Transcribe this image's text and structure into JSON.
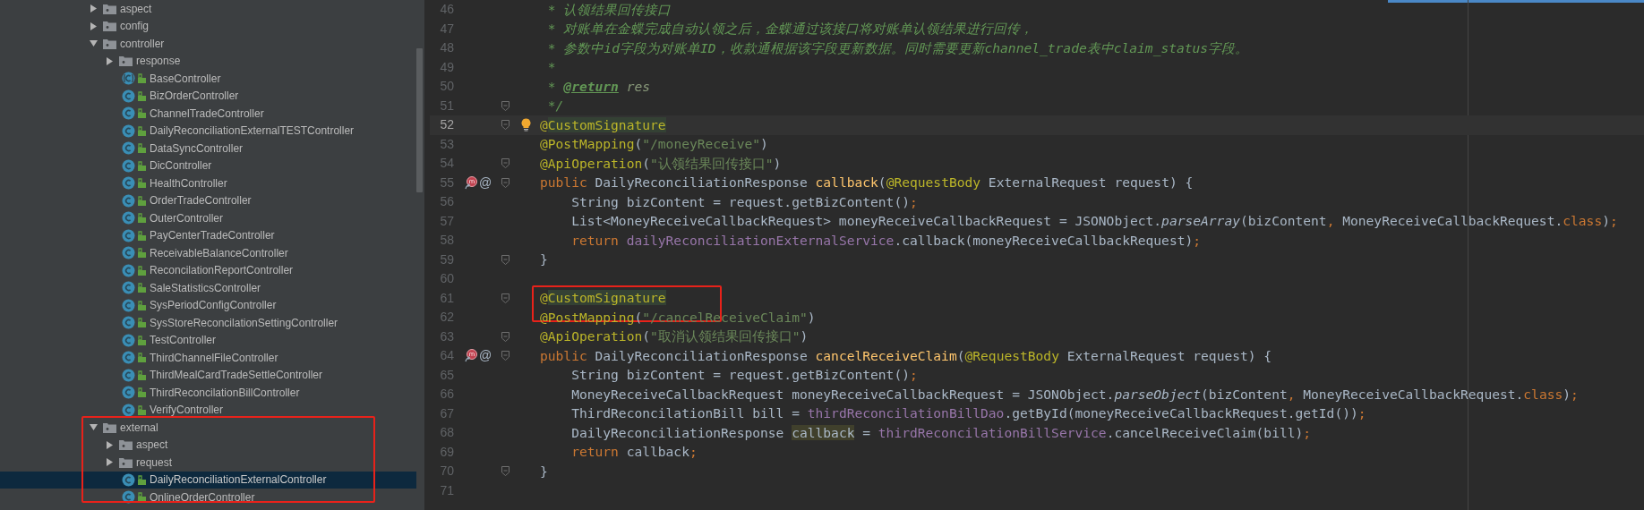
{
  "project_tree": {
    "items": [
      {
        "kind": "package",
        "label": "aspect",
        "expanded": false,
        "selected": false,
        "highlighted": false
      },
      {
        "kind": "package",
        "label": "config",
        "expanded": false,
        "selected": false,
        "highlighted": false
      },
      {
        "kind": "package",
        "label": "controller",
        "expanded": true,
        "selected": false,
        "highlighted": false,
        "children": [
          {
            "kind": "package",
            "label": "response",
            "expanded": false,
            "selected": false
          },
          {
            "kind": "abstract_class",
            "label": "BaseController",
            "selected": false
          },
          {
            "kind": "class",
            "label": "BizOrderController",
            "selected": false
          },
          {
            "kind": "class",
            "label": "ChannelTradeController",
            "selected": false
          },
          {
            "kind": "class",
            "label": "DailyReconciliationExternalTESTController",
            "selected": false
          },
          {
            "kind": "class",
            "label": "DataSyncController",
            "selected": false
          },
          {
            "kind": "class",
            "label": "DicController",
            "selected": false
          },
          {
            "kind": "class",
            "label": "HealthController",
            "selected": false
          },
          {
            "kind": "class",
            "label": "OrderTradeController",
            "selected": false
          },
          {
            "kind": "class",
            "label": "OuterController",
            "selected": false
          },
          {
            "kind": "class",
            "label": "PayCenterTradeController",
            "selected": false
          },
          {
            "kind": "class",
            "label": "ReceivableBalanceController",
            "selected": false
          },
          {
            "kind": "class",
            "label": "ReconcilationReportController",
            "selected": false
          },
          {
            "kind": "class",
            "label": "SaleStatisticsController",
            "selected": false
          },
          {
            "kind": "class",
            "label": "SysPeriodConfigController",
            "selected": false
          },
          {
            "kind": "class",
            "label": "SysStoreReconcilationSettingController",
            "selected": false
          },
          {
            "kind": "class",
            "label": "TestController",
            "selected": false
          },
          {
            "kind": "class",
            "label": "ThirdChannelFileController",
            "selected": false
          },
          {
            "kind": "class",
            "label": "ThirdMealCardTradeSettleController",
            "selected": false
          },
          {
            "kind": "class",
            "label": "ThirdReconcilationBillController",
            "selected": false
          },
          {
            "kind": "class",
            "label": "VerifyController",
            "selected": false
          }
        ]
      },
      {
        "kind": "package",
        "label": "external",
        "expanded": true,
        "selected": false,
        "highlighted": true,
        "children": [
          {
            "kind": "package",
            "label": "aspect",
            "expanded": false,
            "selected": false
          },
          {
            "kind": "package",
            "label": "request",
            "expanded": false,
            "selected": false
          },
          {
            "kind": "class",
            "label": "DailyReconciliationExternalController",
            "selected": true
          },
          {
            "kind": "class",
            "label": "OnlineOrderController",
            "selected": false
          }
        ]
      }
    ]
  },
  "editor": {
    "lines": [
      {
        "number": "46",
        "current": false,
        "highlighted": false,
        "tokens": [
          {
            "text": " * 认领结果回传接口",
            "kind": "comment"
          }
        ]
      },
      {
        "number": "47",
        "current": false,
        "highlighted": false,
        "tokens": [
          {
            "text": " * 对账单在金蝶完成自动认领之后，金蝶通过该接口将对账单认领结果进行回传，",
            "kind": "comment"
          }
        ]
      },
      {
        "number": "48",
        "current": false,
        "highlighted": false,
        "tokens": [
          {
            "text": " * 参数中id字段为对账单ID，收款通根据该字段更新数据。同时需要更新channel_trade表中claim_status字段。",
            "kind": "comment"
          }
        ]
      },
      {
        "number": "49",
        "current": false,
        "highlighted": false,
        "tokens": [
          {
            "text": " *",
            "kind": "comment"
          }
        ]
      },
      {
        "number": "50",
        "current": false,
        "highlighted": false,
        "tokens": [
          {
            "text": " * ",
            "kind": "comment"
          },
          {
            "text": "@return",
            "kind": "doctag"
          },
          {
            "text": " res",
            "kind": "docparam"
          }
        ]
      },
      {
        "number": "51",
        "current": false,
        "highlighted": false,
        "fold": true,
        "tokens": [
          {
            "text": " */",
            "kind": "comment"
          }
        ]
      },
      {
        "number": "52",
        "current": true,
        "highlighted": false,
        "fold": true,
        "bulb": true,
        "tokens": [
          {
            "text": "@",
            "kind": "annotation"
          },
          {
            "text": "CustomSignature",
            "kind": "annotation_marked"
          }
        ]
      },
      {
        "number": "53",
        "current": false,
        "highlighted": false,
        "tokens": [
          {
            "text": "@PostMapping",
            "kind": "annotation"
          },
          {
            "text": "(",
            "kind": "plain"
          },
          {
            "text": "\"/moneyReceive\"",
            "kind": "string"
          },
          {
            "text": ")",
            "kind": "plain"
          }
        ]
      },
      {
        "number": "54",
        "current": false,
        "highlighted": false,
        "fold": true,
        "tokens": [
          {
            "text": "@ApiOperation",
            "kind": "annotation"
          },
          {
            "text": "(",
            "kind": "plain"
          },
          {
            "text": "\"认领结果回传接口\"",
            "kind": "string"
          },
          {
            "text": ")",
            "kind": "plain"
          }
        ]
      },
      {
        "number": "55",
        "current": false,
        "highlighted": false,
        "fold": true,
        "mapping": true,
        "gutter": "@",
        "tokens": [
          {
            "text": "public ",
            "kind": "keyword"
          },
          {
            "text": "DailyReconciliationResponse ",
            "kind": "plain"
          },
          {
            "text": "callback",
            "kind": "method"
          },
          {
            "text": "(",
            "kind": "plain"
          },
          {
            "text": "@RequestBody ",
            "kind": "annotation"
          },
          {
            "text": "ExternalRequest request) {",
            "kind": "plain"
          }
        ]
      },
      {
        "number": "56",
        "current": false,
        "highlighted": false,
        "tokens": [
          {
            "text": "    String bizContent = request.getBizContent()",
            "kind": "plain"
          },
          {
            "text": ";",
            "kind": "keyword"
          }
        ]
      },
      {
        "number": "57",
        "current": false,
        "highlighted": false,
        "tokens": [
          {
            "text": "    List<MoneyReceiveCallbackRequest> moneyReceiveCallbackRequest = JSONObject.",
            "kind": "plain"
          },
          {
            "text": "parseArray",
            "kind": "static"
          },
          {
            "text": "(bizContent",
            "kind": "plain"
          },
          {
            "text": ", ",
            "kind": "keyword"
          },
          {
            "text": "MoneyReceiveCallbackRequest.",
            "kind": "plain"
          },
          {
            "text": "class",
            "kind": "keyword"
          },
          {
            "text": ")",
            "kind": "plain"
          },
          {
            "text": ";",
            "kind": "keyword"
          }
        ]
      },
      {
        "number": "58",
        "current": false,
        "highlighted": false,
        "tokens": [
          {
            "text": "    return ",
            "kind": "keyword"
          },
          {
            "text": "dailyReconciliationExternalService",
            "kind": "field"
          },
          {
            "text": ".callback(moneyReceiveCallbackRequest)",
            "kind": "plain"
          },
          {
            "text": ";",
            "kind": "keyword"
          }
        ]
      },
      {
        "number": "59",
        "current": false,
        "highlighted": false,
        "fold": true,
        "tokens": [
          {
            "text": "}",
            "kind": "plain"
          }
        ]
      },
      {
        "number": "60",
        "current": false,
        "highlighted": false
      },
      {
        "number": "61",
        "current": false,
        "highlighted": true,
        "fold": true,
        "tokens": [
          {
            "text": "@",
            "kind": "annotation"
          },
          {
            "text": "CustomSignature",
            "kind": "annotation_marked"
          }
        ]
      },
      {
        "number": "62",
        "current": false,
        "highlighted": false,
        "tokens": [
          {
            "text": "@PostMapping",
            "kind": "annotation"
          },
          {
            "text": "(",
            "kind": "plain"
          },
          {
            "text": "\"/cancelReceiveClaim\"",
            "kind": "string"
          },
          {
            "text": ")",
            "kind": "plain"
          }
        ]
      },
      {
        "number": "63",
        "current": false,
        "highlighted": false,
        "fold": true,
        "tokens": [
          {
            "text": "@ApiOperation",
            "kind": "annotation"
          },
          {
            "text": "(",
            "kind": "plain"
          },
          {
            "text": "\"取消认领结果回传接口\"",
            "kind": "string"
          },
          {
            "text": ")",
            "kind": "plain"
          }
        ]
      },
      {
        "number": "64",
        "current": false,
        "highlighted": false,
        "fold": true,
        "mapping": true,
        "gutter": "@",
        "tokens": [
          {
            "text": "public ",
            "kind": "keyword"
          },
          {
            "text": "DailyReconciliationResponse ",
            "kind": "plain"
          },
          {
            "text": "cancelReceiveClaim",
            "kind": "method"
          },
          {
            "text": "(",
            "kind": "plain"
          },
          {
            "text": "@RequestBody ",
            "kind": "annotation"
          },
          {
            "text": "ExternalRequest request) {",
            "kind": "plain"
          }
        ]
      },
      {
        "number": "65",
        "current": false,
        "highlighted": false,
        "tokens": [
          {
            "text": "    String bizContent = request.getBizContent()",
            "kind": "plain"
          },
          {
            "text": ";",
            "kind": "keyword"
          }
        ]
      },
      {
        "number": "66",
        "current": false,
        "highlighted": false,
        "tokens": [
          {
            "text": "    MoneyReceiveCallbackRequest moneyReceiveCallbackRequest = JSONObject.",
            "kind": "plain"
          },
          {
            "text": "parseObject",
            "kind": "static"
          },
          {
            "text": "(bizContent",
            "kind": "plain"
          },
          {
            "text": ", ",
            "kind": "keyword"
          },
          {
            "text": "MoneyReceiveCallbackRequest.",
            "kind": "plain"
          },
          {
            "text": "class",
            "kind": "keyword"
          },
          {
            "text": ")",
            "kind": "plain"
          },
          {
            "text": ";",
            "kind": "keyword"
          }
        ]
      },
      {
        "number": "67",
        "current": false,
        "highlighted": false,
        "tokens": [
          {
            "text": "    ThirdReconcilationBill bill = ",
            "kind": "plain"
          },
          {
            "text": "thirdReconcilationBillDao",
            "kind": "field"
          },
          {
            "text": ".getById(moneyReceiveCallbackRequest.getId())",
            "kind": "plain"
          },
          {
            "text": ";",
            "kind": "keyword"
          }
        ]
      },
      {
        "number": "68",
        "current": false,
        "highlighted": false,
        "tokens": [
          {
            "text": "    DailyReconciliationResponse ",
            "kind": "plain"
          },
          {
            "text": "callback",
            "kind": "usage"
          },
          {
            "text": " = ",
            "kind": "plain"
          },
          {
            "text": "thirdReconcilationBillService",
            "kind": "field"
          },
          {
            "text": ".cancelReceiveClaim(bill)",
            "kind": "plain"
          },
          {
            "text": ";",
            "kind": "keyword"
          }
        ]
      },
      {
        "number": "69",
        "current": false,
        "highlighted": false,
        "tokens": [
          {
            "text": "    return ",
            "kind": "keyword"
          },
          {
            "text": "callback",
            "kind": "plain"
          },
          {
            "text": ";",
            "kind": "keyword"
          }
        ]
      },
      {
        "number": "70",
        "current": false,
        "highlighted": false,
        "fold": true,
        "tokens": [
          {
            "text": "}",
            "kind": "plain"
          }
        ]
      },
      {
        "number": "71",
        "current": false,
        "highlighted": false
      }
    ]
  }
}
